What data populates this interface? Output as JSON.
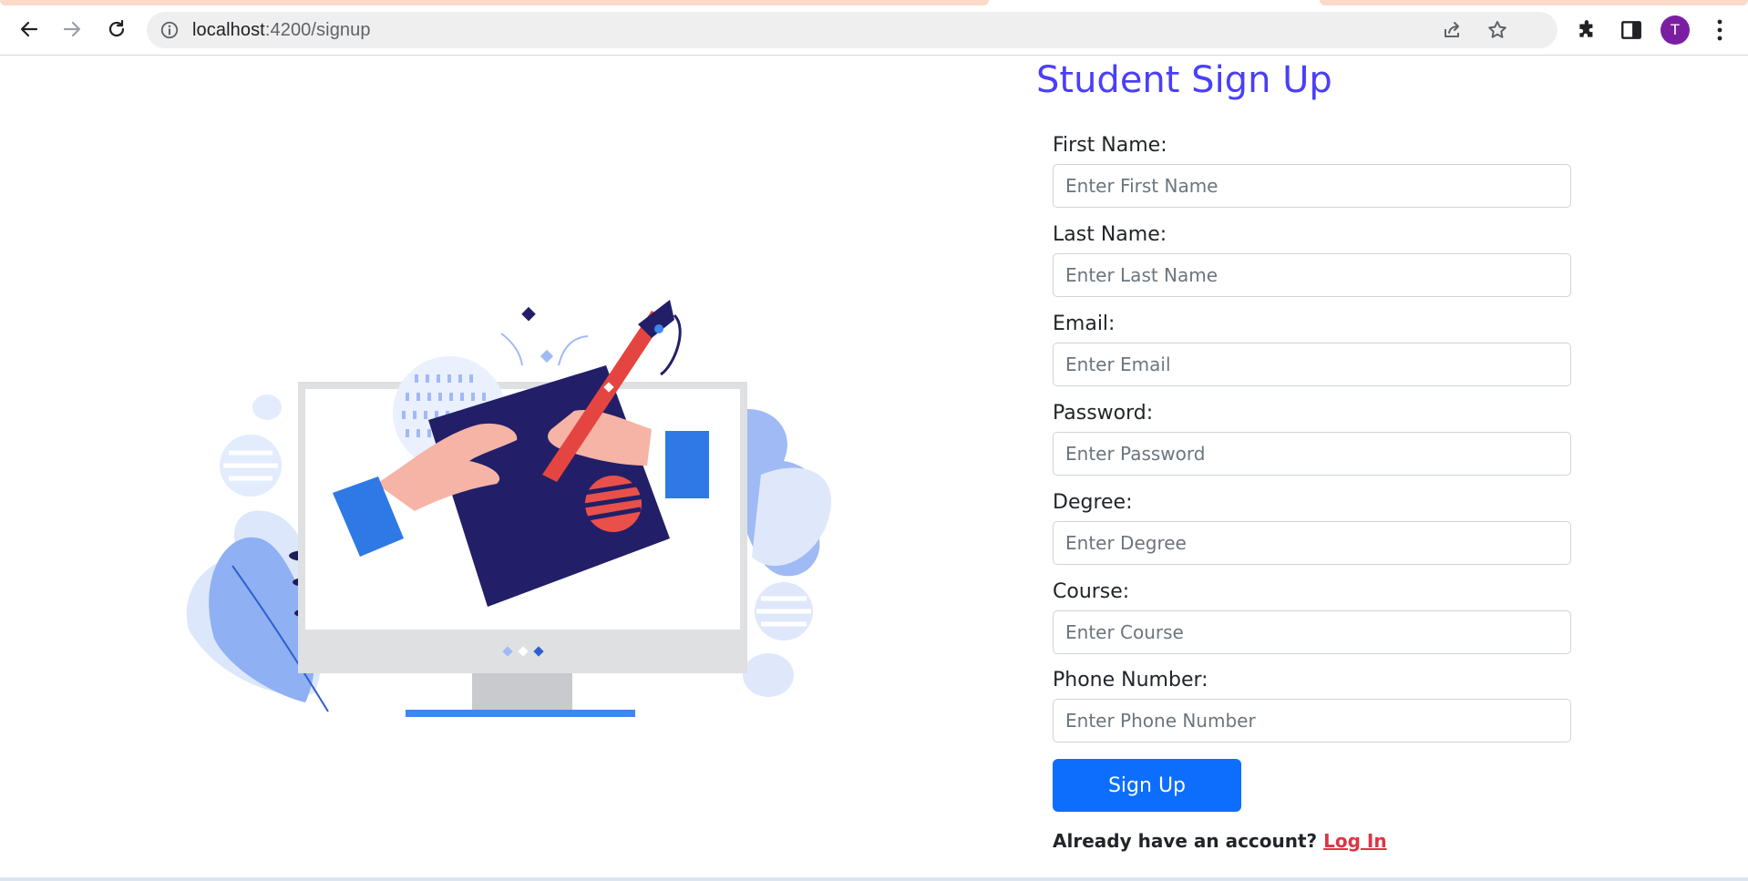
{
  "browser": {
    "url_host": "localhost",
    "url_path": ":4200/signup",
    "profile_initial": "T",
    "icons": {
      "back": "arrow-left-icon",
      "forward": "arrow-right-icon",
      "reload": "reload-icon",
      "site_info": "info-icon",
      "share": "share-icon",
      "bookmark": "star-icon",
      "extensions": "puzzle-icon",
      "side_panel": "side-panel-icon",
      "menu": "kebab-menu-icon"
    }
  },
  "signup": {
    "title": "Student Sign Up",
    "fields": [
      {
        "label": "First Name:",
        "placeholder": "Enter First Name",
        "value": ""
      },
      {
        "label": "Last Name:",
        "placeholder": "Enter Last Name",
        "value": ""
      },
      {
        "label": "Email:",
        "placeholder": "Enter Email",
        "value": ""
      },
      {
        "label": "Password:",
        "placeholder": "Enter Password",
        "value": ""
      },
      {
        "label": "Degree:",
        "placeholder": "Enter Degree",
        "value": ""
      },
      {
        "label": "Course:",
        "placeholder": "Enter Course",
        "value": ""
      },
      {
        "label": "Phone Number:",
        "placeholder": "Enter Phone Number",
        "value": ""
      }
    ],
    "submit_label": "Sign Up",
    "login_prompt": "Already have an account?",
    "login_link": "Log In"
  },
  "colors": {
    "title": "#4a3ff7",
    "primary_button": "#0d6efd",
    "login_link": "#dc3545",
    "avatar": "#7b1fa2"
  }
}
